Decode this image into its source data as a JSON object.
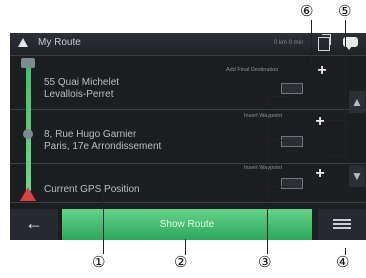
{
  "screen": {
    "title": "My Route",
    "top_mid_text": "0 km 0 min",
    "items": [
      {
        "line1": "55 Quai Michelet",
        "line2": "Levallois-Perret"
      },
      {
        "line1": "8, Rue Hugo Garnier",
        "line2": "Paris, 17e Arrondissement"
      },
      {
        "line1": "Current GPS Position",
        "line2": ""
      }
    ],
    "mini_labels": [
      "Add Final Destination",
      "Insert Waypoint",
      "Insert Waypoint"
    ],
    "button_show_route": "Show Route",
    "callouts": [
      "①",
      "②",
      "③",
      "④",
      "⑤",
      "⑥"
    ]
  }
}
